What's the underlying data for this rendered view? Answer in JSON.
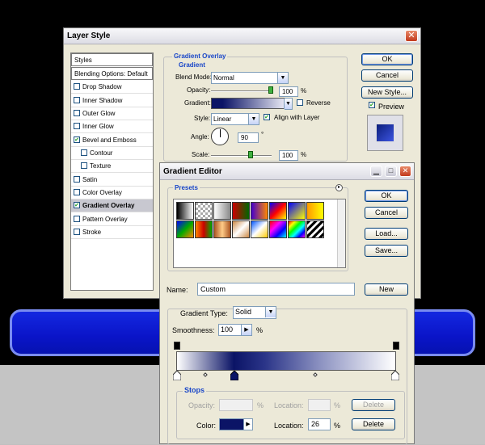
{
  "layer_style": {
    "title": "Layer Style",
    "sidebar_header": "Styles",
    "sidebar": [
      {
        "label": "Blending Options: Default",
        "checkbox": false
      },
      {
        "label": "Drop Shadow",
        "checkbox": true,
        "checked": false
      },
      {
        "label": "Inner Shadow",
        "checkbox": true,
        "checked": false
      },
      {
        "label": "Outer Glow",
        "checkbox": true,
        "checked": false
      },
      {
        "label": "Inner Glow",
        "checkbox": true,
        "checked": false
      },
      {
        "label": "Bevel and Emboss",
        "checkbox": true,
        "checked": true
      },
      {
        "label": "Contour",
        "checkbox": true,
        "checked": false
      },
      {
        "label": "Texture",
        "checkbox": true,
        "checked": false
      },
      {
        "label": "Satin",
        "checkbox": true,
        "checked": false
      },
      {
        "label": "Color Overlay",
        "checkbox": true,
        "checked": false
      },
      {
        "label": "Gradient Overlay",
        "checkbox": true,
        "checked": true
      },
      {
        "label": "Pattern Overlay",
        "checkbox": true,
        "checked": false
      },
      {
        "label": "Stroke",
        "checkbox": true,
        "checked": false
      }
    ],
    "section_title": "Gradient Overlay",
    "group_title": "Gradient",
    "blend_mode_label": "Blend Mode:",
    "blend_mode_value": "Normal",
    "opacity_label": "Opacity:",
    "opacity_value": "100",
    "percent": "%",
    "gradient_label": "Gradient:",
    "reverse_label": "Reverse",
    "style_label": "Style:",
    "style_value": "Linear",
    "align_label": "Align with Layer",
    "angle_label": "Angle:",
    "angle_value": "90",
    "degree": "°",
    "scale_label": "Scale:",
    "scale_value": "100",
    "ok": "OK",
    "cancel": "Cancel",
    "new_style": "New Style...",
    "preview_label": "Preview",
    "close_glyph": "✕"
  },
  "gradient_editor": {
    "title": "Gradient Editor",
    "presets_label": "Presets",
    "ok": "OK",
    "cancel": "Cancel",
    "load": "Load...",
    "save": "Save...",
    "name_label": "Name:",
    "name_value": "Custom",
    "new_button": "New",
    "gradient_type_label": "Gradient Type:",
    "gradient_type_value": "Solid",
    "smoothness_label": "Smoothness:",
    "smoothness_value": "100",
    "percent": "%",
    "stops_label": "Stops",
    "opacity_label": "Opacity:",
    "location_label": "Location:",
    "delete": "Delete",
    "color_label": "Color:",
    "color_location_value": "26",
    "color_stop_color": "#0b1466"
  }
}
